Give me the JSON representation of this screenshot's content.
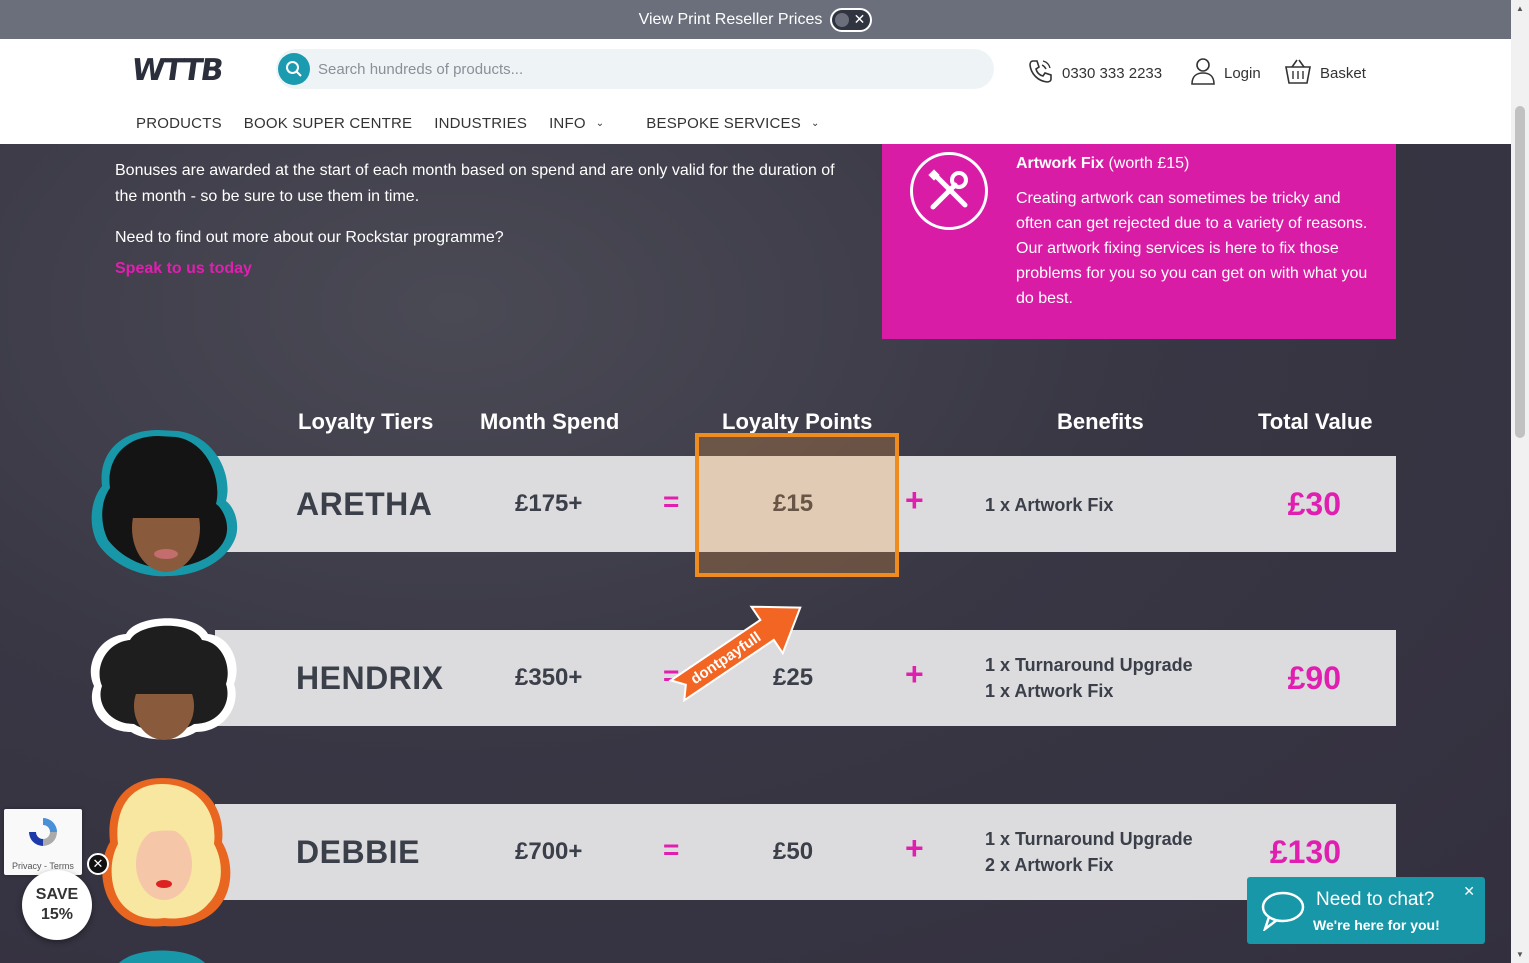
{
  "reseller_bar": {
    "label": "View Print Reseller Prices",
    "toggle_close": "✕"
  },
  "header": {
    "logo": "WTTB",
    "search_placeholder": "Search hundreds of products...",
    "phone": "0330 333 2233",
    "login": "Login",
    "basket": "Basket"
  },
  "nav": {
    "products": "PRODUCTS",
    "book_super_centre": "BOOK SUPER CENTRE",
    "industries": "INDUSTRIES",
    "info": "INFO",
    "bespoke": "BESPOKE SERVICES"
  },
  "intro": {
    "paragraph1": "Bonuses are awarded at the start of each month based on spend and are only valid for the duration of the month - so be sure to use them in time.",
    "paragraph2": "Need to find out more about our Rockstar programme?",
    "link": "Speak to us today"
  },
  "artwork_box": {
    "title_bold": "Artwork Fix",
    "title_rest": " (worth £15)",
    "description": "Creating artwork can sometimes be tricky and often can get rejected due to a variety of reasons. Our artwork fixing services is here to fix those problems for you so you can get on with what you do best."
  },
  "table": {
    "headers": {
      "tiers": "Loyalty Tiers",
      "spend": "Month Spend",
      "points": "Loyalty Points",
      "benefits": "Benefits",
      "total": "Total Value"
    },
    "rows": [
      {
        "name": "ARETHA",
        "spend": "£175+",
        "eq": "=",
        "points": "£15",
        "plus": "+",
        "benefit1": "1 x Artwork Fix",
        "benefit2": "",
        "total": "£30"
      },
      {
        "name": "HENDRIX",
        "spend": "£350+",
        "eq": "=",
        "points": "£25",
        "plus": "+",
        "benefit1": "1 x Turnaround Upgrade",
        "benefit2": "1 x Artwork Fix",
        "total": "£90"
      },
      {
        "name": "DEBBIE",
        "spend": "£700+",
        "eq": "=",
        "points": "£50",
        "plus": "+",
        "benefit1": "1 x Turnaround Upgrade",
        "benefit2": "2 x Artwork Fix",
        "total": "£130"
      }
    ]
  },
  "promo_arrow": {
    "label": "dontpayfull"
  },
  "recaptcha": {
    "text": "Privacy - Terms"
  },
  "save_badge": {
    "line1": "SAVE",
    "line2": "15%",
    "close": "✕"
  },
  "chat": {
    "title": "Need to chat?",
    "subtitle": "We're here for you!",
    "close": "✕"
  },
  "colors": {
    "accent": "#d81ca5",
    "highlight": "#f08c1e",
    "chat": "#1797a8"
  }
}
